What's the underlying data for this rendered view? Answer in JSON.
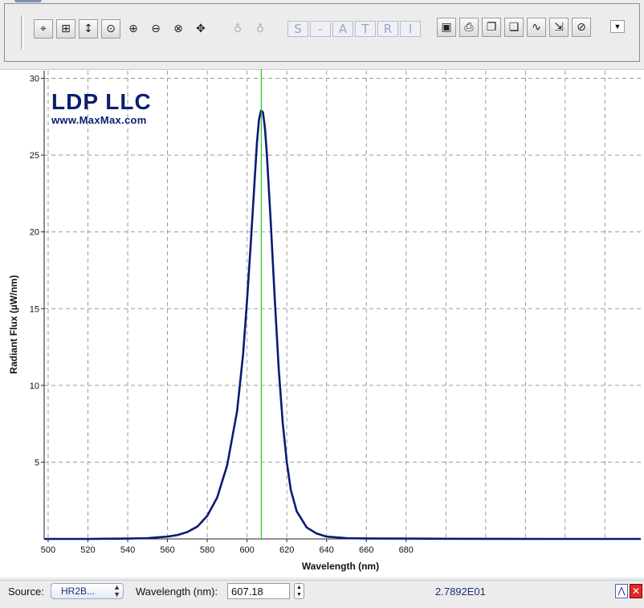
{
  "toolbar": {
    "buttons": [
      {
        "name": "crosshair-tool-button",
        "icon": "crosshair-icon",
        "glyph": "⌖"
      },
      {
        "name": "zoom-box-button",
        "icon": "zoom-box-icon",
        "glyph": "⊞"
      },
      {
        "name": "zoom-vertical-button",
        "icon": "zoom-vertical-icon",
        "glyph": "↕"
      },
      {
        "name": "zoom-fit-button",
        "icon": "zoom-fit-icon",
        "glyph": "⊙"
      },
      {
        "name": "zoom-in-button",
        "icon": "zoom-in-icon",
        "glyph": "⊕"
      },
      {
        "name": "zoom-out-button",
        "icon": "zoom-out-icon",
        "glyph": "⊖"
      },
      {
        "name": "zoom-reset-button",
        "icon": "zoom-reset-icon",
        "glyph": "⊗"
      },
      {
        "name": "pan-button",
        "icon": "move-arrows-icon",
        "glyph": "✥"
      },
      {
        "name": "lamp-off-button",
        "icon": "lamp-off-icon",
        "glyph": "♁"
      },
      {
        "name": "lamp-on-button",
        "icon": "lamp-on-icon",
        "glyph": "♁"
      }
    ],
    "mode_letters": [
      "S",
      "-",
      "A",
      "T",
      "R",
      "I"
    ],
    "file_buttons": [
      {
        "name": "save-button",
        "icon": "floppy-disk-icon",
        "glyph": "▣"
      },
      {
        "name": "print-button",
        "icon": "printer-icon",
        "glyph": "⎙"
      },
      {
        "name": "copy-button",
        "icon": "copy-icon",
        "glyph": "❐"
      },
      {
        "name": "copy-image-button",
        "icon": "copy-image-icon",
        "glyph": "❏"
      },
      {
        "name": "graph-button",
        "icon": "graph-line-icon",
        "glyph": "∿"
      },
      {
        "name": "export-button",
        "icon": "export-icon",
        "glyph": "⇲"
      },
      {
        "name": "delete-button",
        "icon": "delete-icon",
        "glyph": "⊘"
      }
    ],
    "dropdown_glyph": "▼"
  },
  "logo": {
    "title": "LDP LLC",
    "url": "www.MaxMax.com"
  },
  "chart_data": {
    "type": "line",
    "title": "",
    "xlabel": "Wavelength (nm)",
    "ylabel": "Radiant Flux (µW/nm)",
    "xlim": [
      498,
      798
    ],
    "ylim": [
      0,
      30.5
    ],
    "xticks": [
      500,
      520,
      540,
      560,
      580,
      600,
      620,
      640,
      660,
      680
    ],
    "yticks": [
      5,
      10,
      15,
      20,
      25,
      30
    ],
    "grid": true,
    "colors": {
      "series": "#0b1a74",
      "cursor": "#22cc22",
      "grid": "#9a9a9a"
    },
    "cursor_x": 607.18,
    "series": [
      {
        "x": [
          498,
          520,
          540,
          550,
          560,
          565,
          570,
          575,
          580,
          585,
          590,
          595,
          598,
          600,
          602,
          604,
          605,
          606,
          607,
          608,
          609,
          610,
          612,
          614,
          616,
          618,
          620,
          622,
          625,
          630,
          635,
          640,
          650,
          660,
          680,
          700,
          750,
          798
        ],
        "y": [
          0,
          0,
          0.02,
          0.05,
          0.15,
          0.25,
          0.45,
          0.8,
          1.5,
          2.7,
          4.8,
          8.3,
          12.0,
          15.5,
          19.5,
          23.7,
          25.8,
          27.3,
          27.9,
          27.8,
          26.8,
          25.0,
          20.5,
          15.5,
          11.0,
          7.5,
          5.0,
          3.2,
          1.8,
          0.75,
          0.35,
          0.15,
          0.05,
          0.03,
          0.02,
          0.01,
          0,
          0
        ]
      }
    ]
  },
  "status": {
    "source_label": "Source:",
    "source_value": "HR2B...",
    "wavelength_label": "Wavelength (nm):",
    "wavelength_value": "607.18",
    "readout": "2.7892E01"
  }
}
